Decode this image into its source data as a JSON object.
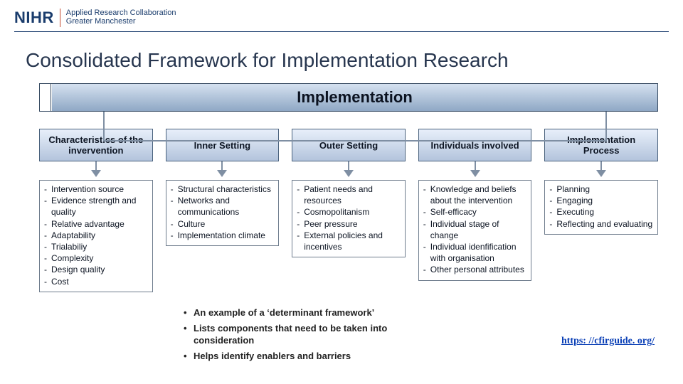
{
  "logo": {
    "mark": "NIHR",
    "sub1": "Applied Research Collaboration",
    "sub2": "Greater Manchester"
  },
  "title": "Consolidated Framework for Implementation Research",
  "banner": "Implementation",
  "columns": [
    {
      "header": "Characteristics of the invervention",
      "items": [
        "Intervention source",
        "Evidence strength and quality",
        "Relative advantage",
        "Adaptability",
        "Trialabiliy",
        "Complexity",
        "Design quality",
        "Cost"
      ]
    },
    {
      "header": "Inner Setting",
      "items": [
        "Structural characteristics",
        "Networks and communications",
        "Culture",
        "Implementation climate"
      ]
    },
    {
      "header": "Outer Setting",
      "items": [
        "Patient needs and resources",
        "Cosmopolitanism",
        "Peer pressure",
        "External policies and incentives"
      ]
    },
    {
      "header": "Individuals involved",
      "items": [
        "Knowledge and beliefs about the intervention",
        "Self-efficacy",
        "Individual stage of change",
        "Individual idenfification with organisation",
        "Other personal attributes"
      ]
    },
    {
      "header": "Implementation Process",
      "items": [
        "Planning",
        "Engaging",
        "Executing",
        "Reflecting and evaluating"
      ]
    }
  ],
  "bullets": [
    "An example of a ‘determinant framework’",
    "Lists components that need to be taken into consideration",
    "Helps identify enablers and barriers"
  ],
  "link_text": "https: //cfirguide. org/"
}
